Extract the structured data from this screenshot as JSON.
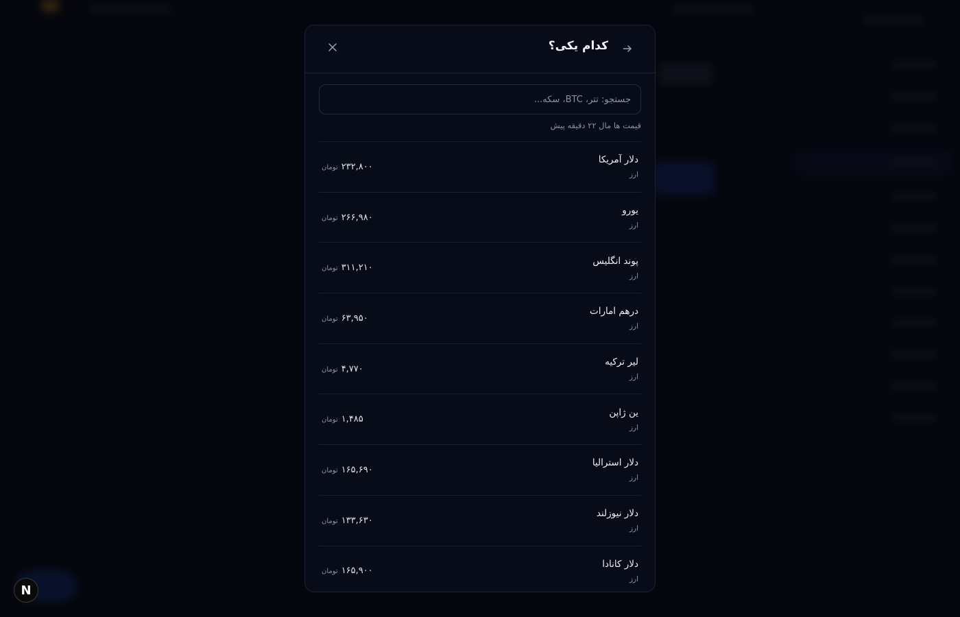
{
  "modal": {
    "title": "کدام یکی؟",
    "back_icon": "arrow-right-icon",
    "close_icon": "close-icon",
    "search_placeholder": "جستجو: تتر، BTC، سکه...",
    "update_note": "قیمت ها مال ۲۲ دقیقه پیش",
    "items": [
      {
        "name": "دلار آمریکا",
        "category": "ارز",
        "price": "۲۳۲,۸۰۰",
        "unit": "تومان"
      },
      {
        "name": "یورو",
        "category": "ارز",
        "price": "۲۶۶,۹۸۰",
        "unit": "تومان"
      },
      {
        "name": "پوند انگلیس",
        "category": "ارز",
        "price": "۳۱۱,۲۱۰",
        "unit": "تومان"
      },
      {
        "name": "درهم امارات",
        "category": "ارز",
        "price": "۶۳,۹۵۰",
        "unit": "تومان"
      },
      {
        "name": "لیر ترکیه",
        "category": "ارز",
        "price": "۴,۷۷۰",
        "unit": "تومان"
      },
      {
        "name": "ین ژاپن",
        "category": "ارز",
        "price": "۱,۴۸۵",
        "unit": "تومان"
      },
      {
        "name": "دلار استرالیا",
        "category": "ارز",
        "price": "۱۶۵,۶۹۰",
        "unit": "تومان"
      },
      {
        "name": "دلار نیوزلند",
        "category": "ارز",
        "price": "۱۳۳,۶۳۰",
        "unit": "تومان"
      },
      {
        "name": "دلار کانادا",
        "category": "ارز",
        "price": "۱۶۵,۹۰۰",
        "unit": "تومان"
      }
    ]
  },
  "badge": {
    "label": "N"
  },
  "colors": {
    "background": "#070912",
    "modal_bg": "#080c18",
    "border": "#1c2236",
    "accent": "#1a3a8a"
  }
}
